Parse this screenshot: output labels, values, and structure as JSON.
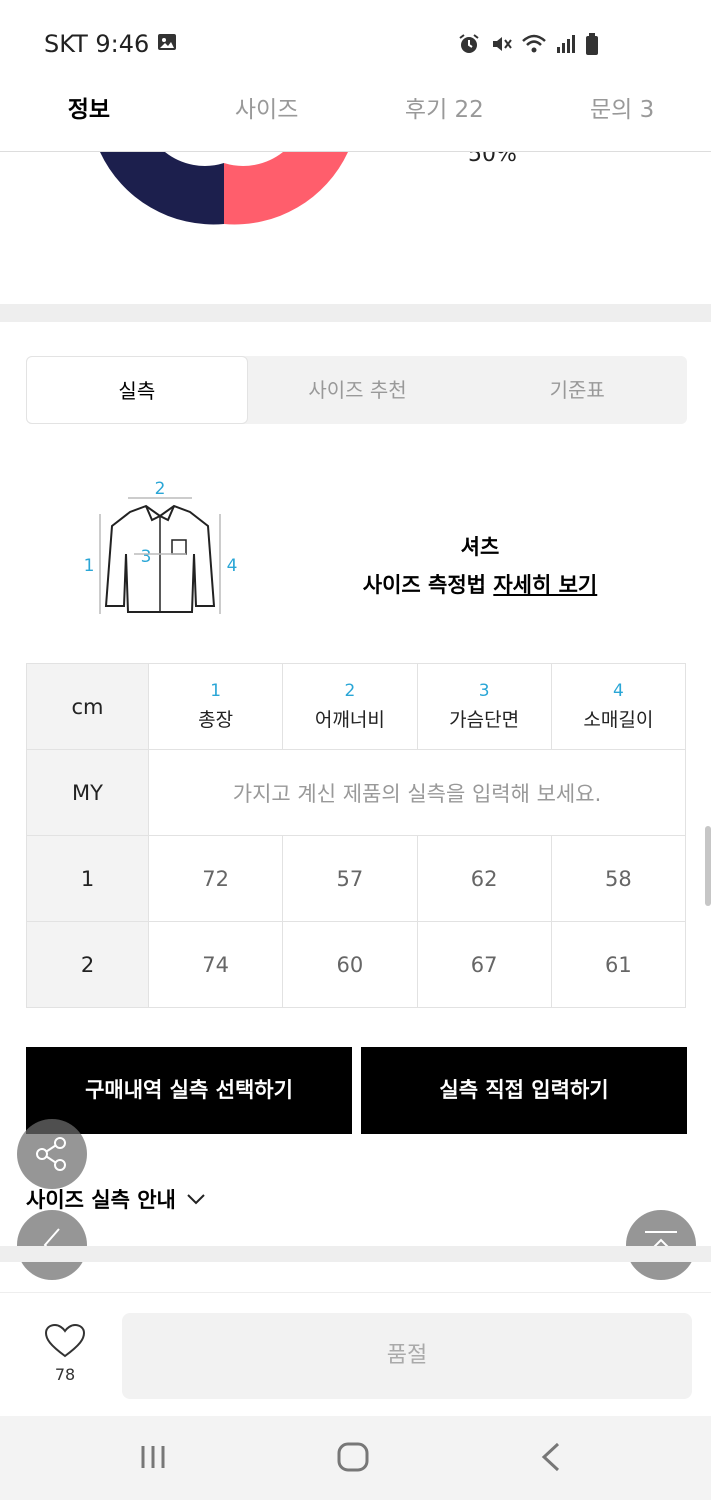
{
  "status_bar": {
    "carrier_time": "SKT 9:46",
    "icons": [
      "image-icon",
      "alarm-icon",
      "mute-icon",
      "wifi-icon",
      "signal-icon",
      "battery-icon"
    ]
  },
  "top_tabs": [
    {
      "label": "정보",
      "active": true
    },
    {
      "label": "사이즈",
      "active": false
    },
    {
      "label": "후기 22",
      "active": false
    },
    {
      "label": "문의 3",
      "active": false
    }
  ],
  "donut": {
    "percent_text": "50%",
    "colors": {
      "left": "#1c1f4d",
      "right": "#ff5e6c"
    }
  },
  "size_tabs": [
    {
      "label": "실측",
      "active": true
    },
    {
      "label": "사이즈 추천",
      "active": false
    },
    {
      "label": "기준표",
      "active": false
    }
  ],
  "measure": {
    "type": "셔츠",
    "method_prefix": "사이즈 측정법 ",
    "detail_link": "자세히 보기",
    "diagram_numbers": [
      "1",
      "2",
      "3",
      "4"
    ]
  },
  "table": {
    "unit": "cm",
    "columns": [
      {
        "num": "1",
        "label": "총장"
      },
      {
        "num": "2",
        "label": "어깨너비"
      },
      {
        "num": "3",
        "label": "가슴단면"
      },
      {
        "num": "4",
        "label": "소매길이"
      }
    ],
    "my_row": {
      "label": "MY",
      "prompt": "가지고 계신 제품의 실측을 입력해 보세요."
    },
    "rows": [
      {
        "size": "1",
        "values": [
          "72",
          "57",
          "62",
          "58"
        ]
      },
      {
        "size": "2",
        "values": [
          "74",
          "60",
          "67",
          "61"
        ]
      }
    ]
  },
  "buttons": {
    "select_history": "구매내역 실측 선택하기",
    "direct_input": "실측 직접 입력하기"
  },
  "guide": {
    "label": "사이즈 실측 안내"
  },
  "bottom": {
    "like_count": "78",
    "soldout": "품절"
  },
  "accent_color": "#2aa6d6"
}
